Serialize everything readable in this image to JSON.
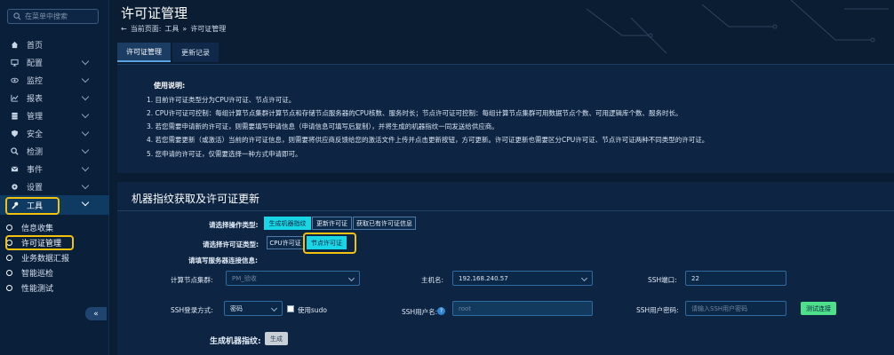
{
  "sidebar": {
    "search_placeholder": "在菜单中搜索",
    "items": [
      {
        "label": "首页",
        "icon": "home-icon",
        "chevron": false
      },
      {
        "label": "配置",
        "icon": "monitor-icon",
        "chevron": true
      },
      {
        "label": "监控",
        "icon": "eye-icon",
        "chevron": true
      },
      {
        "label": "报表",
        "icon": "chart-icon",
        "chevron": true
      },
      {
        "label": "管理",
        "icon": "database-icon",
        "chevron": true
      },
      {
        "label": "安全",
        "icon": "shield-icon",
        "chevron": true
      },
      {
        "label": "检测",
        "icon": "search-icon",
        "chevron": true
      },
      {
        "label": "事件",
        "icon": "mail-icon",
        "chevron": true
      },
      {
        "label": "设置",
        "icon": "gear-icon",
        "chevron": true
      },
      {
        "label": "工具",
        "icon": "wrench-icon",
        "chevron": true
      }
    ],
    "sub_items": [
      "信息收集",
      "许可证管理",
      "业务数据汇报",
      "智能巡检",
      "性能测试"
    ],
    "collapse_label": "«"
  },
  "header": {
    "title": "许可证管理",
    "crumb_prefix": "当前页面:",
    "crumb_parent": "工具",
    "crumb_sep": "»",
    "crumb_current": "许可证管理"
  },
  "tabs": [
    "许可证管理",
    "更新记录"
  ],
  "instructions": {
    "title": "使用说明:",
    "lines": [
      "1. 目前许可证类型分为CPU许可证、节点许可证。",
      "2. CPU许可证可控制：每组计算节点集群计算节点和存储节点服务器的CPU核数、服务时长；节点许可证可控制：每组计算节点集群可用数据节点个数、可用逻辑库个数、服务时长。",
      "3. 若您需要申请新的许可证，则需要填写申请信息（申请信息可填写后复制），并将生成的机器指纹一同发送给供应商。",
      "4. 若您需要更新（或激活）当前的许可证信息，则需要将供应商反馈给您的激活文件上传并点击更新按钮，方可更新。许可证更新也需要区分CPU许可证、节点许可证两种不同类型的许可证。",
      "5. 您申请的许可证，仅需要选择一种方式申请即可。"
    ]
  },
  "section": {
    "title": "机器指纹获取及许可证更新",
    "op_label": "请选择操作类型:",
    "op_buttons": [
      "生成机器指纹",
      "更新许可证",
      "获取已有许可证信息"
    ],
    "lic_label": "请选择许可证类型:",
    "lic_buttons": [
      "CPU许可证",
      "节点许可证"
    ],
    "conn_label": "请填写服务器连接信息:",
    "cluster_label": "计算节点集群:",
    "cluster_value": "PM_验收",
    "host_label": "主机名:",
    "host_value": "192.168.240.57",
    "ssh_port_label": "SSH端口:",
    "ssh_port_value": "22",
    "ssh_login_label": "SSH登录方式:",
    "ssh_login_value": "密码",
    "sudo_label": "使用sudo",
    "ssh_user_label": "SSH用户名:",
    "ssh_user_value": "root",
    "ssh_pwd_label": "SSH用户密码:",
    "ssh_pwd_placeholder": "请输入SSH用户密码",
    "test_btn": "测试连接",
    "gen_label": "生成机器指纹:",
    "gen_btn": "生成"
  },
  "colors": {
    "accent": "#19d6e6",
    "highlight": "#f3c20f",
    "success": "#4fe08b",
    "bg": "#0b1d33"
  }
}
